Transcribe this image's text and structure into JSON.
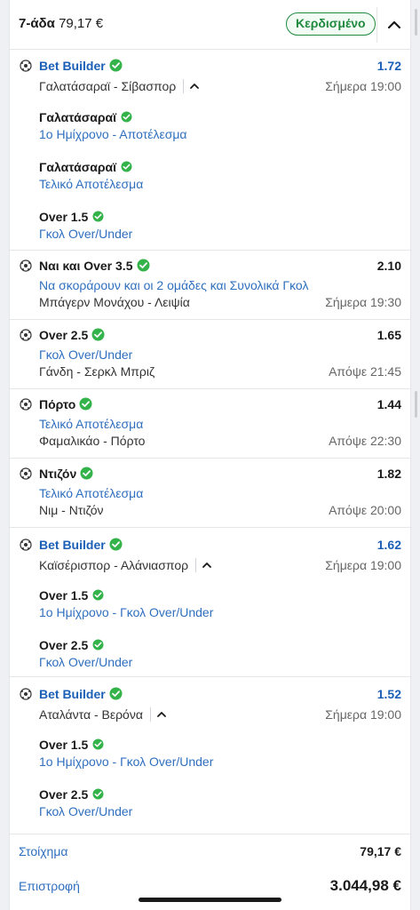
{
  "header": {
    "bet_type": "7-άδα",
    "stake": "79,17 €",
    "status": "Κερδισμένο"
  },
  "selections": [
    {
      "name": "Bet Builder",
      "odds": "1.72",
      "match": "Γαλατάσαραϊ - Σίβασπορ",
      "time": "Σήμερα 19:00",
      "legs": [
        {
          "name": "Γαλατάσαραϊ",
          "market": "1ο Ημίχρονο - Αποτέλεσμα"
        },
        {
          "name": "Γαλατάσαραϊ",
          "market": "Τελικό Αποτέλεσμα"
        },
        {
          "name": "Over 1.5",
          "market": "Γκολ Over/Under"
        }
      ]
    },
    {
      "name": "Ναι και Over 3.5",
      "odds": "2.10",
      "market": "Να σκοράρουν και οι 2 ομάδες και Συνολικά Γκολ",
      "match": "Μπάγερν Μονάχου - Λειψία",
      "time": "Σήμερα 19:30"
    },
    {
      "name": "Over 2.5",
      "odds": "1.65",
      "market": "Γκολ Over/Under",
      "match": "Γάνδη - Σερκλ Μπριζ",
      "time": "Απόψε 21:45"
    },
    {
      "name": "Πόρτο",
      "odds": "1.44",
      "market": "Τελικό Αποτέλεσμα",
      "match": "Φαμαλικάο - Πόρτο",
      "time": "Απόψε 22:30"
    },
    {
      "name": "Ντιζόν",
      "odds": "1.82",
      "market": "Τελικό Αποτέλεσμα",
      "match": "Νιμ - Ντιζόν",
      "time": "Απόψε 20:00"
    },
    {
      "name": "Bet Builder",
      "odds": "1.62",
      "match": "Καϊσέρισπορ - Αλάνιασπορ",
      "time": "Σήμερα 19:00",
      "legs": [
        {
          "name": "Over 1.5",
          "market": "1ο Ημίχρονο - Γκολ Over/Under"
        },
        {
          "name": "Over 2.5",
          "market": "Γκολ Over/Under"
        }
      ]
    },
    {
      "name": "Bet Builder",
      "odds": "1.52",
      "match": "Αταλάντα - Βερόνα",
      "time": "Σήμερα 19:00",
      "legs": [
        {
          "name": "Over 1.5",
          "market": "1ο Ημίχρονο - Γκολ Over/Under"
        },
        {
          "name": "Over 2.5",
          "market": "Γκολ Over/Under"
        }
      ]
    }
  ],
  "footer": {
    "stake_label": "Στοίχημα",
    "stake_value": "79,17 €",
    "return_label": "Επιστροφή",
    "return_value": "3.044,98 €"
  },
  "colors": {
    "accent_blue": "#1b5fb6",
    "market_blue": "#2f6fbf",
    "win_green": "#1f8a3e",
    "check_green": "#34b34a"
  },
  "icons": [
    "soccer-ball-icon",
    "check-circle-icon",
    "chevron-up-icon"
  ]
}
